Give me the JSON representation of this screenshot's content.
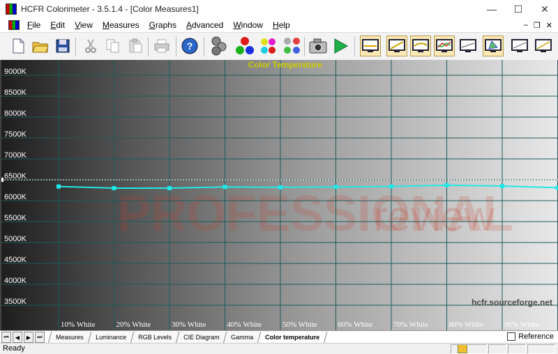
{
  "window": {
    "title": "HCFR Colorimeter - 3.5.1.4 - [Color Measures1]",
    "controls": {
      "minimize": "—",
      "maximize": "☐",
      "close": "✕"
    }
  },
  "menu": {
    "items": [
      "File",
      "Edit",
      "View",
      "Measures",
      "Graphs",
      "Advanced",
      "Window",
      "Help"
    ],
    "mdi": {
      "minimize": "–",
      "restore": "❐",
      "close": "✕"
    }
  },
  "toolbar": {
    "buttons": [
      "new-file",
      "open-folder",
      "save-disk",
      "cut-scissors",
      "copy",
      "paste",
      "print",
      "help",
      "multi-sensor",
      "rgb-balls",
      "color-balls",
      "spheres-grid",
      "camera",
      "play"
    ],
    "toggles": [
      "graph-colortemp",
      "graph-luminance",
      "graph-gamma",
      "graph-rgb-levels",
      "graph-measures",
      "graph-cie",
      "graph-a",
      "graph-b"
    ]
  },
  "chart_data": {
    "type": "line",
    "title": "Color Temperature",
    "title_color": "#cccc00",
    "ylabel": "",
    "xlabel": "",
    "y_ticks": [
      "9000K",
      "8500K",
      "8000K",
      "7500K",
      "7000K",
      "6500K",
      "6000K",
      "5500K",
      "5000K",
      "4500K",
      "4000K",
      "3500K"
    ],
    "categories": [
      "10% White",
      "20% White",
      "30% White",
      "40% White",
      "50% White",
      "60% White",
      "70% White",
      "80% White",
      "90% White"
    ],
    "ylim": [
      3000,
      9500
    ],
    "reference": 6500,
    "series": [
      {
        "color": "#20e8e8",
        "values": [
          6340,
          6300,
          6300,
          6330,
          6320,
          6330,
          6340,
          6370,
          6350,
          6310
        ]
      }
    ],
    "watermark_lines": [
      "PROFESSIONAL",
      "review"
    ],
    "site_label": "hcfr.sourceforge.net"
  },
  "tabs": {
    "items": [
      "Measures",
      "Luminance",
      "RGB Levels",
      "CIE Diagram",
      "Gamma",
      "Color temperature"
    ],
    "active": "Color temperature",
    "reference_label": "Reference"
  },
  "status": {
    "text": "Ready"
  }
}
